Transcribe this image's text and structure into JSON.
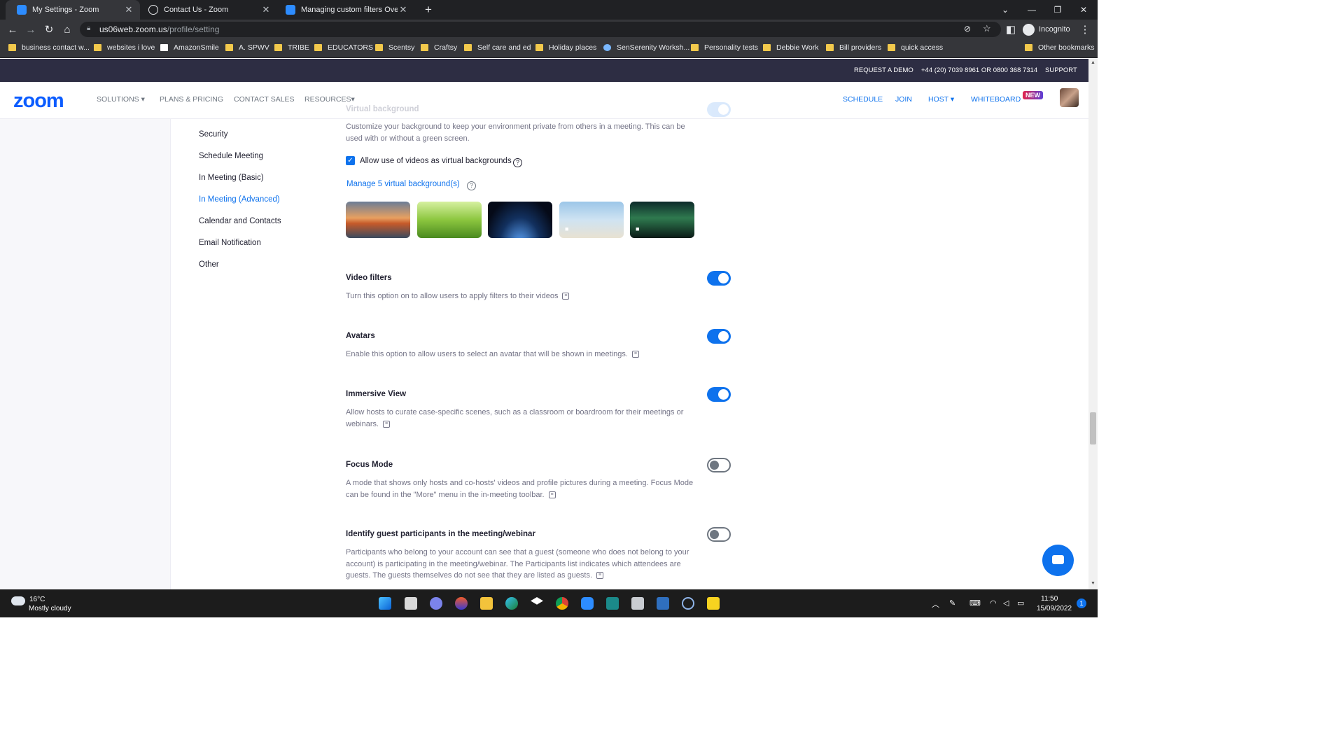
{
  "browser": {
    "tabs": [
      {
        "title": "My Settings - Zoom",
        "favicon": "zoom-icon"
      },
      {
        "title": "Contact Us - Zoom",
        "favicon": "globe-icon"
      },
      {
        "title": "Managing custom filters Overview",
        "favicon": "zoom-icon"
      }
    ],
    "url_host": "us06web.zoom.us",
    "url_path": "/profile/setting",
    "profile_label": "Incognito",
    "bookmarks": [
      "business contact w...",
      "websites i love",
      "AmazonSmile",
      "A. SPWV",
      "TRIBE",
      "EDUCATORS",
      "Scentsy",
      "Craftsy",
      "Self care and ed",
      "Holiday places",
      "SenSerenity Worksh...",
      "Personality tests",
      "Debbie Work",
      "Bill providers",
      "quick access"
    ],
    "other_bookmarks": "Other bookmarks"
  },
  "topbar": {
    "request_demo": "REQUEST A DEMO",
    "phone": "+44 (20) 7039 8961 OR 0800 368 7314",
    "support": "SUPPORT"
  },
  "nav": {
    "logo": "zoom",
    "solutions": "SOLUTIONS",
    "plans": "PLANS & PRICING",
    "contact_sales": "CONTACT SALES",
    "resources": "RESOURCES",
    "schedule": "SCHEDULE",
    "join": "JOIN",
    "host": "HOST",
    "whiteboard": "WHITEBOARD",
    "new_badge": "NEW"
  },
  "sidebar": {
    "items": [
      {
        "label": "Security"
      },
      {
        "label": "Schedule Meeting"
      },
      {
        "label": "In Meeting (Basic)"
      },
      {
        "label": "In Meeting (Advanced)"
      },
      {
        "label": "Calendar and Contacts"
      },
      {
        "label": "Email Notification"
      },
      {
        "label": "Other"
      }
    ],
    "active_index": 3
  },
  "content": {
    "virtual_bg_heading": "Virtual background",
    "virtual_bg_desc": "Customize your background to keep your environment private from others in a meeting. This can be used with or without a green screen.",
    "allow_videos_label": "Allow use of videos as virtual backgrounds",
    "allow_videos_checked": true,
    "manage_link": "Manage 5 virtual background(s)",
    "thumbnails": [
      "golden-gate-bridge",
      "green-grass",
      "earth-from-space",
      "tropical-beach",
      "northern-lights"
    ],
    "settings": [
      {
        "title": "Video filters",
        "desc": "Turn this option on to allow users to apply filters to their videos",
        "enabled": true
      },
      {
        "title": "Avatars",
        "desc": "Enable this option to allow users to select an avatar that will be shown in meetings.",
        "enabled": true
      },
      {
        "title": "Immersive View",
        "desc": "Allow hosts to curate case-specific scenes, such as a classroom or boardroom for their meetings or webinars.",
        "enabled": true
      },
      {
        "title": "Focus Mode",
        "desc": "A mode that shows only hosts and co-hosts' videos and profile pictures during a meeting. Focus Mode can be found in the \"More\" menu in the in-meeting toolbar.",
        "enabled": false
      },
      {
        "title": "Identify guest participants in the meeting/webinar",
        "desc": "Participants who belong to your account can see that a guest (someone who does not belong to your account) is participating in the meeting/webinar. The Participants list indicates which attendees are guests. The guests themselves do not see that they are listed as guests.",
        "enabled": false
      }
    ]
  },
  "taskbar": {
    "temperature": "16°C",
    "weather": "Mostly cloudy",
    "time": "11:50",
    "date": "15/09/2022",
    "notification_count": "1"
  },
  "colors": {
    "accent": "#0e72ed",
    "topbar": "#2d2d43",
    "browser_dark": "#202124"
  }
}
